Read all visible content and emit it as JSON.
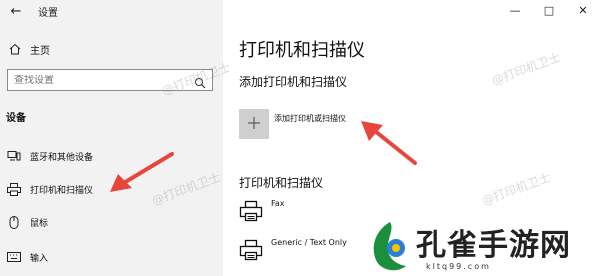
{
  "window": {
    "title": "设置",
    "controls": {
      "minimize": "—",
      "maximize": "□",
      "close": "✕"
    }
  },
  "sidebar": {
    "home_label": "主页",
    "search_placeholder": "查找设置",
    "section_title": "设备",
    "items": [
      {
        "label": "蓝牙和其他设备",
        "icon": "bluetooth-devices-icon"
      },
      {
        "label": "打印机和扫描仪",
        "icon": "printer-icon"
      },
      {
        "label": "鼠标",
        "icon": "mouse-icon"
      },
      {
        "label": "输入",
        "icon": "keyboard-icon"
      }
    ]
  },
  "main": {
    "title": "打印机和扫描仪",
    "add_heading": "添加打印机和扫描仪",
    "add_button_label": "添加打印机或扫描仪",
    "list_heading": "打印机和扫描仪",
    "printers": [
      {
        "name": "Fax",
        "icon": "printer-icon"
      },
      {
        "name": "Generic / Text Only",
        "icon": "printer-icon"
      }
    ]
  },
  "watermark_text": "@打印机卫士",
  "logo": {
    "text": "孔雀手游网",
    "url": "kltq99.com"
  },
  "colors": {
    "sidebar_bg": "#f2f2f2",
    "arrow": "#e8453c",
    "tile": "#cfcfcf"
  }
}
